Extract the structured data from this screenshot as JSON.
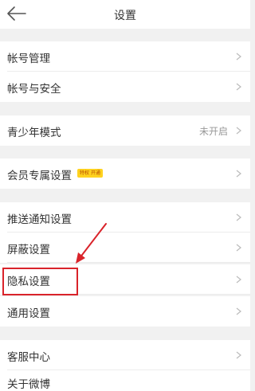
{
  "header": {
    "title": "设置",
    "back_icon": "back-arrow-icon"
  },
  "rows": [
    {
      "label": "帐号管理"
    },
    {
      "label": "帐号与安全"
    },
    {
      "label": "青少年模式",
      "value": "未开启"
    },
    {
      "label": "会员专属设置",
      "badge": "特权 开通"
    },
    {
      "label": "推送通知设置"
    },
    {
      "label": "屏蔽设置"
    },
    {
      "label": "隐私设置",
      "highlighted": true
    },
    {
      "label": "通用设置"
    },
    {
      "label": "客服中心"
    },
    {
      "label": "关于微博"
    }
  ],
  "colors": {
    "highlight": "#d9232a",
    "badge": "#ffd21f"
  }
}
